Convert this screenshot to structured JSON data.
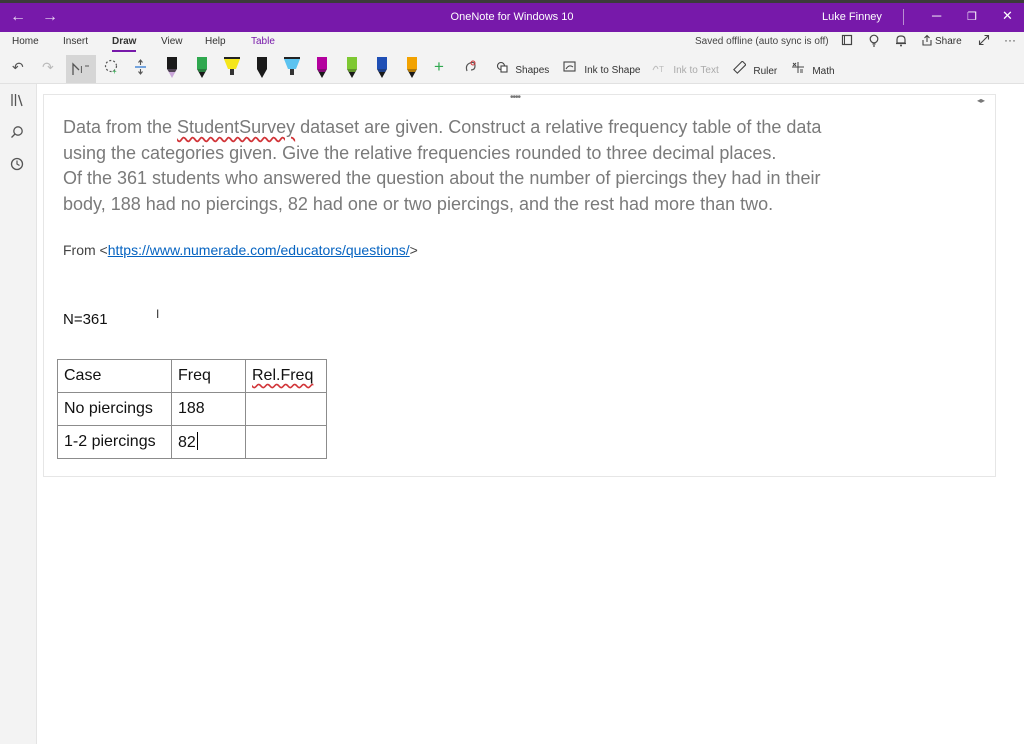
{
  "window": {
    "back_glyph": "←",
    "forward_glyph": "→",
    "title": "OneNote for Windows 10",
    "user": "Luke Finney",
    "minimize_glyph": "─",
    "restore_glyph": "❐",
    "close_glyph": "✕"
  },
  "menu": {
    "tabs": [
      "Home",
      "Insert",
      "Draw",
      "View",
      "Help",
      "Table"
    ],
    "active_tab": "Draw",
    "sync_status": "Saved offline (auto sync is off)",
    "share_label": "Share",
    "more_glyph": "···"
  },
  "toolbar": {
    "undo_glyph": "↶",
    "redo_glyph": "↷",
    "pens": [
      {
        "name": "pen-black",
        "color": "#1a1a1a",
        "tip": "#c9a6d9"
      },
      {
        "name": "pen-green",
        "color": "#2fa84f",
        "tip": "#1a1a1a"
      },
      {
        "name": "highlighter-yellow",
        "color": "#f5e61c",
        "tip": "#1a1a1a"
      },
      {
        "name": "pen-black-2",
        "color": "#1a1a1a",
        "tip": "#1a1a1a"
      },
      {
        "name": "highlighter-blue",
        "color": "#5cc3f0",
        "tip": "#1a1a1a"
      },
      {
        "name": "pen-purple",
        "color": "#b4009e",
        "tip": "#1a1a1a"
      },
      {
        "name": "pen-green-2",
        "color": "#7ec832",
        "tip": "#1a1a1a"
      },
      {
        "name": "pen-blue",
        "color": "#1f4fb5",
        "tip": "#1a1a1a"
      },
      {
        "name": "pen-orange",
        "color": "#f2a200",
        "tip": "#1a1a1a"
      }
    ],
    "add_pen_glyph": "+",
    "shapes_label": "Shapes",
    "ink_to_shape_label": "Ink to Shape",
    "ink_to_text_label": "Ink to Text",
    "ruler_label": "Ruler",
    "math_label": "Math"
  },
  "note": {
    "question_lines": [
      "Data from the StudentSurvey dataset are given. Construct a relative frequency table of the data",
      "using the categories given. Give the relative frequencies rounded to three decimal places.",
      "Of the 361 students who answered the question about the number of piercings they had in their",
      "body, 188 had no piercings, 82 had one or two piercings, and the rest had more than two."
    ],
    "squiggle_word": "StudentSurvey",
    "from_prefix": "From <",
    "from_link": "https://www.numerade.com/educators/questions/",
    "from_suffix": ">",
    "n_line": "N=361",
    "table": {
      "headers": [
        "Case",
        "Freq",
        "Rel.Freq"
      ],
      "rows": [
        [
          "No piercings",
          "188",
          ""
        ],
        [
          "1-2 piercings",
          "82",
          ""
        ]
      ]
    }
  },
  "colors": {
    "titlebar": "#7719aa",
    "ribbon": "#f3f3f3",
    "question_text": "#7a7a7a",
    "link": "#0563c1"
  }
}
